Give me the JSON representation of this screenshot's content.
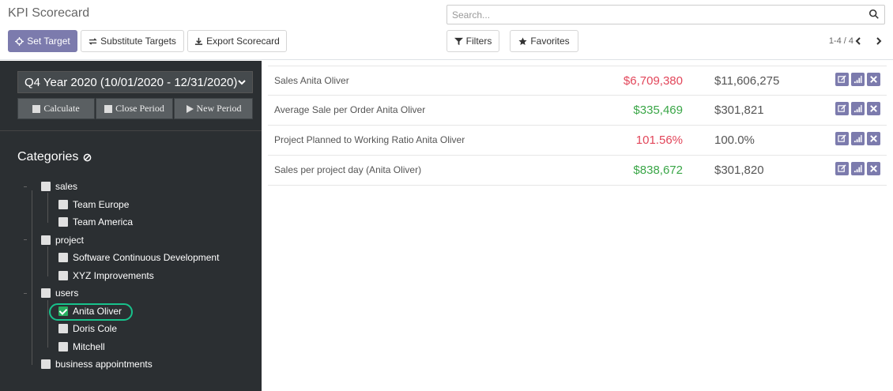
{
  "header": {
    "title": "KPI Scorecard",
    "search_placeholder": "Search...",
    "set_target": "Set Target",
    "substitute_targets": "Substitute Targets",
    "export_scorecard": "Export Scorecard",
    "filters": "Filters",
    "favorites": "Favorites",
    "pager": "1-4 / 4"
  },
  "sidebar": {
    "period": "Q4 Year 2020 (10/01/2020 - 12/31/2020)",
    "calculate": "Calculate",
    "close_period": "Close Period",
    "new_period": "New Period",
    "categories_title": "Categories",
    "tree": [
      {
        "label": "sales",
        "level": 0,
        "checked": false
      },
      {
        "label": "Team Europe",
        "level": 1,
        "checked": false
      },
      {
        "label": "Team America",
        "level": 1,
        "checked": false
      },
      {
        "label": "project",
        "level": 0,
        "checked": false
      },
      {
        "label": "Software Continuous Development",
        "level": 1,
        "checked": false
      },
      {
        "label": "XYZ Improvements",
        "level": 1,
        "checked": false
      },
      {
        "label": "users",
        "level": 0,
        "checked": false
      },
      {
        "label": "Anita Oliver",
        "level": 1,
        "checked": true
      },
      {
        "label": "Doris Cole",
        "level": 1,
        "checked": false
      },
      {
        "label": "Mitchell",
        "level": 1,
        "checked": false
      },
      {
        "label": "business appointments",
        "level": 0,
        "checked": false
      }
    ]
  },
  "kpis": [
    {
      "name": "Sales Anita Oliver",
      "actual": "$6,709,380",
      "status": "red",
      "target": "$11,606,275"
    },
    {
      "name": "Average Sale per Order Anita Oliver",
      "actual": "$335,469",
      "status": "green",
      "target": "$301,821"
    },
    {
      "name": "Project Planned to Working Ratio Anita Oliver",
      "actual": "101.56%",
      "status": "red",
      "target": "100.0%"
    },
    {
      "name": "Sales per project day (Anita Oliver)",
      "actual": "$838,672",
      "status": "green",
      "target": "$301,820"
    }
  ],
  "colors": {
    "accent": "#7c7bad",
    "sidebar": "#2b2f32",
    "red": "#e2465a",
    "green": "#3aa647",
    "highlight": "#18c18b"
  }
}
